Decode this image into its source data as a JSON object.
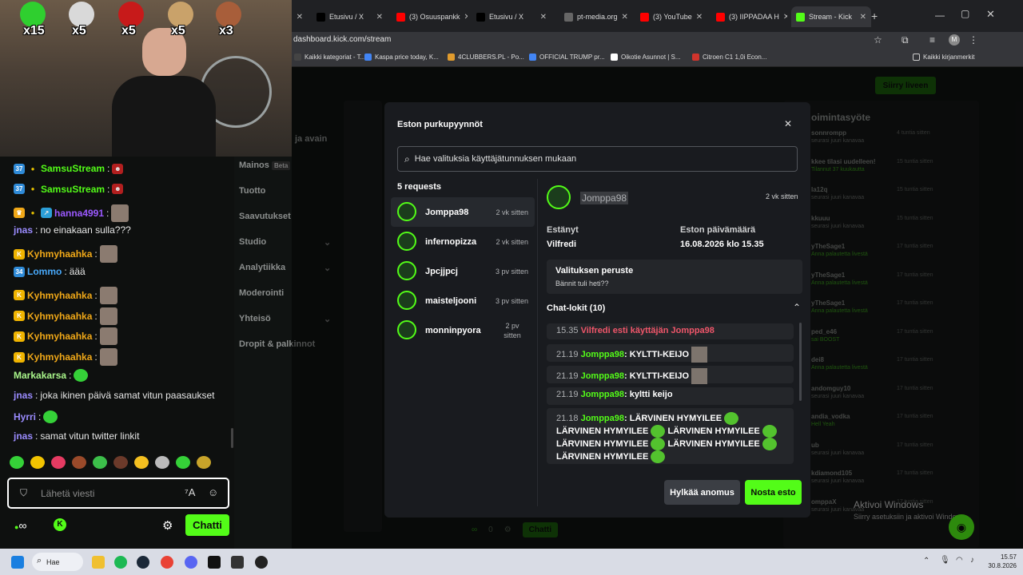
{
  "overlay": {
    "emotes": [
      {
        "mult": "x15",
        "color": "#2fcf2f"
      },
      {
        "mult": "x5",
        "color": "#d9d9d9"
      },
      {
        "mult": "x5",
        "color": "#c71a1a"
      },
      {
        "mult": "x5",
        "color": "#c9a26a"
      },
      {
        "mult": "x3",
        "color": "#a85e3a"
      }
    ]
  },
  "browser": {
    "tabs": [
      {
        "label": "X",
        "icon": "x-icon"
      },
      {
        "label": "Etusivu / X",
        "icon": "x-icon"
      },
      {
        "label": "(3) Osuuspankk",
        "icon": "youtube-icon"
      },
      {
        "label": "Etusivu / X",
        "icon": "x-icon"
      },
      {
        "label": "pt-media.org",
        "icon": "globe-icon"
      },
      {
        "label": "(3) YouTube",
        "icon": "youtube-icon"
      },
      {
        "label": "(3) IIPPADAA H",
        "icon": "youtube-icon"
      },
      {
        "label": "Stream - Kick",
        "icon": "kick-icon"
      }
    ],
    "url": "dashboard.kick.com/stream",
    "profile_initial": "M",
    "bookmarks": [
      "Kaikki kategoriat - T...",
      "Kaspa price today, K...",
      "4CLUBBERS.PL - Po...",
      "OFFICIAL TRUMP pr...",
      "Oikotie Asunnot | S...",
      "Citroen C1 1,0i Econ..."
    ],
    "all_bookmarks": "Kaikki kirjanmerkit"
  },
  "dashboard": {
    "go_live": "Siirry liveen",
    "nav": [
      "Mainos",
      "Tuotto",
      "Saavutukset",
      "Studio",
      "Analytiikka",
      "Moderointi",
      "Yhteisö",
      "Dropit & palkinnot"
    ],
    "nav_beta": "Beta",
    "nav_partial": "ja avain",
    "activity_title": "oimintasyöte",
    "activity": [
      {
        "name": "sonnrompp",
        "sub": "seurasi juuri kanavaa",
        "time": "4 tuntia sitten"
      },
      {
        "name": "kkee tilasi uudelleen!",
        "sub": "Tilannut 37 kuukautta",
        "time": "15 tuntia sitten"
      },
      {
        "name": "la12q",
        "sub": "seurasi juuri kanavaa",
        "time": "15 tuntia sitten"
      },
      {
        "name": "kkuuu",
        "sub": "seurasi juuri kanavaa",
        "time": "15 tuntia sitten"
      },
      {
        "name": "yTheSage1",
        "sub": "Anna palautetta livestä",
        "time": "17 tuntia sitten"
      },
      {
        "name": "yTheSage1",
        "sub": "Anna palautetta livestä",
        "time": "17 tuntia sitten"
      },
      {
        "name": "yTheSage1",
        "sub": "Anna palautetta livestä",
        "time": "17 tuntia sitten"
      },
      {
        "name": "ped_e46",
        "sub": "sai BOOST",
        "time": "17 tuntia sitten"
      },
      {
        "name": "dei8",
        "sub": "Anna palautetta livestä",
        "time": "17 tuntia sitten"
      },
      {
        "name": "andomguy10",
        "sub": "seurasi juuri kanavaa",
        "time": "17 tuntia sitten"
      },
      {
        "name": "andia_vodka",
        "sub": "Hell Yeah",
        "time": "17 tuntia sitten"
      },
      {
        "name": "ub",
        "sub": "seurasi juuri kanavaa",
        "time": "17 tuntia sitten"
      },
      {
        "name": "kdiamond105",
        "sub": "seurasi juuri kanavaa",
        "time": "17 tuntia sitten"
      },
      {
        "name": "omppaX",
        "sub": "seurasi juuri kanavaa",
        "time": "17 tuntia sitten"
      }
    ],
    "bottom_counts": {
      "viewers": "0",
      "chat": "Chatti"
    },
    "activate_windows": {
      "title": "Aktivoi Windows",
      "sub": "Siirry asetuksiin ja aktivoi Windows."
    }
  },
  "chat": {
    "messages": [
      {
        "user": "SamsuStream",
        "text": "",
        "color": "#53fc18",
        "badges": [
          "37"
        ]
      },
      {
        "user": "SamsuStream",
        "text": "",
        "color": "#53fc18",
        "badges": [
          "37"
        ]
      },
      {
        "user": "hanna4991",
        "text": "",
        "color": "#9b59ff",
        "badges": [
          "crown"
        ]
      },
      {
        "user": "jnas",
        "text": "no einakaan sulla???",
        "color": "#9b8cff",
        "badges": []
      },
      {
        "user": "Kyhmyhaahka",
        "text": "",
        "color": "#f0a818",
        "badges": [
          "K"
        ]
      },
      {
        "user": "Lommo",
        "text": "äää",
        "color": "#48a8f8",
        "badges": [
          "34"
        ]
      },
      {
        "user": "Kyhmyhaahka",
        "text": "",
        "color": "#f0a818",
        "badges": [
          "K"
        ]
      },
      {
        "user": "Kyhmyhaahka",
        "text": "",
        "color": "#f0a818",
        "badges": [
          "K"
        ]
      },
      {
        "user": "Kyhmyhaahka",
        "text": "",
        "color": "#f0a818",
        "badges": [
          "K"
        ]
      },
      {
        "user": "Kyhmyhaahka",
        "text": "",
        "color": "#f0a818",
        "badges": [
          "K"
        ]
      },
      {
        "user": "Markakarsa",
        "text": "",
        "color": "#a9f58a",
        "badges": []
      },
      {
        "user": "jnas",
        "text": "joka ikinen päivä samat vitun paasaukset",
        "color": "#9b8cff",
        "badges": []
      },
      {
        "user": "Hyrri",
        "text": "",
        "color": "#9b8cff",
        "badges": []
      },
      {
        "user": "jnas",
        "text": "samat vitun twitter linkit",
        "color": "#9b8cff",
        "badges": []
      }
    ],
    "input_placeholder": "Lähetä viesti",
    "send_label": "Chatti",
    "infinity": "∞"
  },
  "modal": {
    "title": "Eston purkupyynnöt",
    "search_placeholder": "Hae valituksia käyttäjätunnuksen mukaan",
    "count_label": "5 requests",
    "requests": [
      {
        "user": "Jomppa98",
        "time": "2 vk sitten"
      },
      {
        "user": "infernopizza",
        "time": "2 vk sitten"
      },
      {
        "user": "Jpcjjpcj",
        "time": "3 pv sitten"
      },
      {
        "user": "maisteljooni",
        "time": "3 pv sitten"
      },
      {
        "user": "monninpyora",
        "time": "2 pv sitten"
      }
    ],
    "detail": {
      "user": "Jomppa98",
      "time": "2 vk sitten",
      "banned_label": "Estänyt",
      "banned_by": "Vilfredi",
      "ban_date_label": "Eston päivämäärä",
      "ban_date": "16.08.2026 klo 15.35",
      "reason_label": "Valituksen peruste",
      "reason": "Bännit tuli heti??",
      "logs_label": "Chat-lokit (10)",
      "logs": [
        {
          "time": "15.35",
          "text": "Vilfredi esti käyttäjän Jomppa98",
          "type": "ban"
        },
        {
          "time": "21.19",
          "user": "Jomppa98",
          "text": "KYLTTI-KEIJO",
          "type": "msg"
        },
        {
          "time": "21.19",
          "user": "Jomppa98",
          "text": "KYLTTI-KEIJO",
          "type": "msg"
        },
        {
          "time": "21.19",
          "user": "Jomppa98",
          "text": "kyltti keijo",
          "type": "msg"
        },
        {
          "time": "21.18",
          "user": "Jomppa98",
          "text": "LÄRVINEN HYMYILEE",
          "type": "multi"
        }
      ]
    },
    "reject_label": "Hylkää anomus",
    "unban_label": "Nosta esto"
  },
  "taskbar": {
    "search": "Hae",
    "time": "15.57",
    "date": "30.8.2026"
  },
  "colors": {
    "kick_green": "#53fc18",
    "modal_bg": "#191b1f"
  }
}
